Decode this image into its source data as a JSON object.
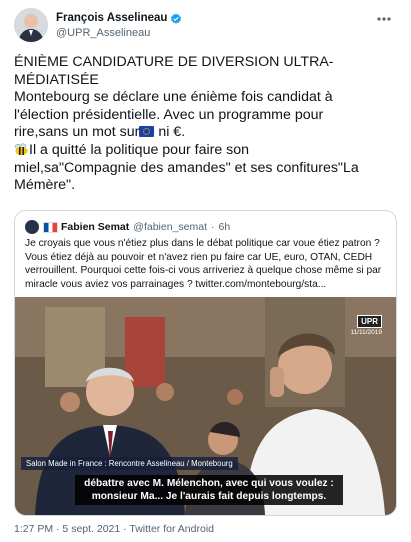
{
  "author": {
    "name": "François Asselineau",
    "handle": "@UPR_Asselineau"
  },
  "tweet": {
    "line1": "ÉNIÈME CANDIDATURE DE DIVERSION ULTRA-",
    "line2": "MÉDIATISÉE",
    "line3": "Montebourg se déclare une énième fois candidat à",
    "line4": "l'élection présidentielle. Avec un programme pour",
    "line5a": "rire,sans un mot sur",
    "line5b": " ni €.",
    "line6": "Il a quitté la politique pour faire son",
    "line7": "miel,sa\"Compagnie des amandes\" et ses confitures\"La",
    "line8": "Mémère\"."
  },
  "quoted": {
    "name": "Fabien Semat",
    "handle": "@fabien_semat",
    "time": "6h",
    "l1": "Je croyais que vous n'étiez plus dans le débat politique car voue étiez patron ?",
    "l2": "Vous étiez déjà au pouvoir et n'avez rien pu faire car UE, euro, OTAN, CEDH",
    "l3": "verrouillent. Pourquoi cette fois-ci vous arriveriez à quelque chose même si par",
    "l4": "miracle vous aviez vos parrainages ?  twitter.com/montebourg/sta...",
    "video": {
      "badge": "UPR",
      "date": "11/11/2019",
      "caption": "Salon Made in France : Rencontre Asselineau / Montebourg",
      "sub1": "débattre avec M. Mélenchon, avec qui vous voulez :",
      "sub2": "monsieur Ma... Je l'aurais fait depuis longtemps."
    }
  },
  "footer": "1:27 PM · 5 sept. 2021 · Twitter for Android",
  "icons": {
    "verified": "verified-badge-icon",
    "more": "more-options-icon",
    "eu_flag": "eu-flag-icon",
    "bee": "bee-icon",
    "fr_flag": "france-flag-icon"
  },
  "colors": {
    "accent": "#1d9bf0",
    "secondary_text": "#536471",
    "border": "#cfd9de"
  }
}
